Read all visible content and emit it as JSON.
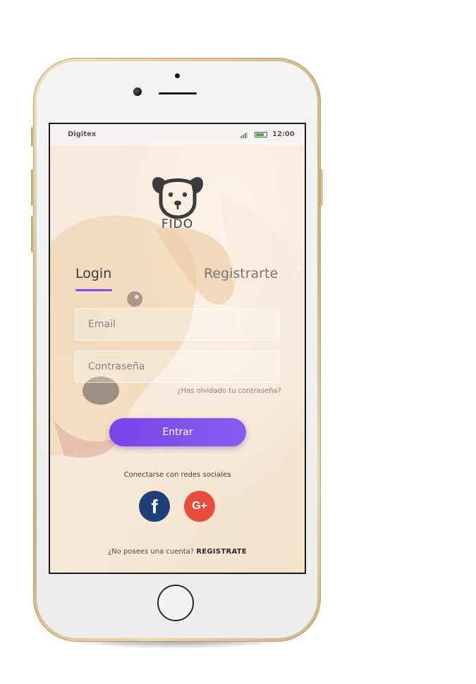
{
  "status_bar": {
    "carrier": "Digitex",
    "time": "12:00"
  },
  "brand": {
    "name": "FIDO",
    "icon": "dog-face-icon"
  },
  "tabs": {
    "login": "Login",
    "register": "Registrarte"
  },
  "form": {
    "email_placeholder": "Email",
    "password_placeholder": "Contraseña",
    "forgot_password": "¿Has olvidado tu contraseña?",
    "submit_label": "Entrar"
  },
  "social": {
    "label": "Conectarse con redes sociales",
    "facebook_glyph": "f",
    "google_glyph": "G+"
  },
  "footer": {
    "prompt": "¿No posees una cuenta?",
    "link": "REGISTRATE"
  },
  "colors": {
    "accent": "#7b4ee8",
    "facebook": "#1f3f78",
    "google": "#e74c3c"
  }
}
